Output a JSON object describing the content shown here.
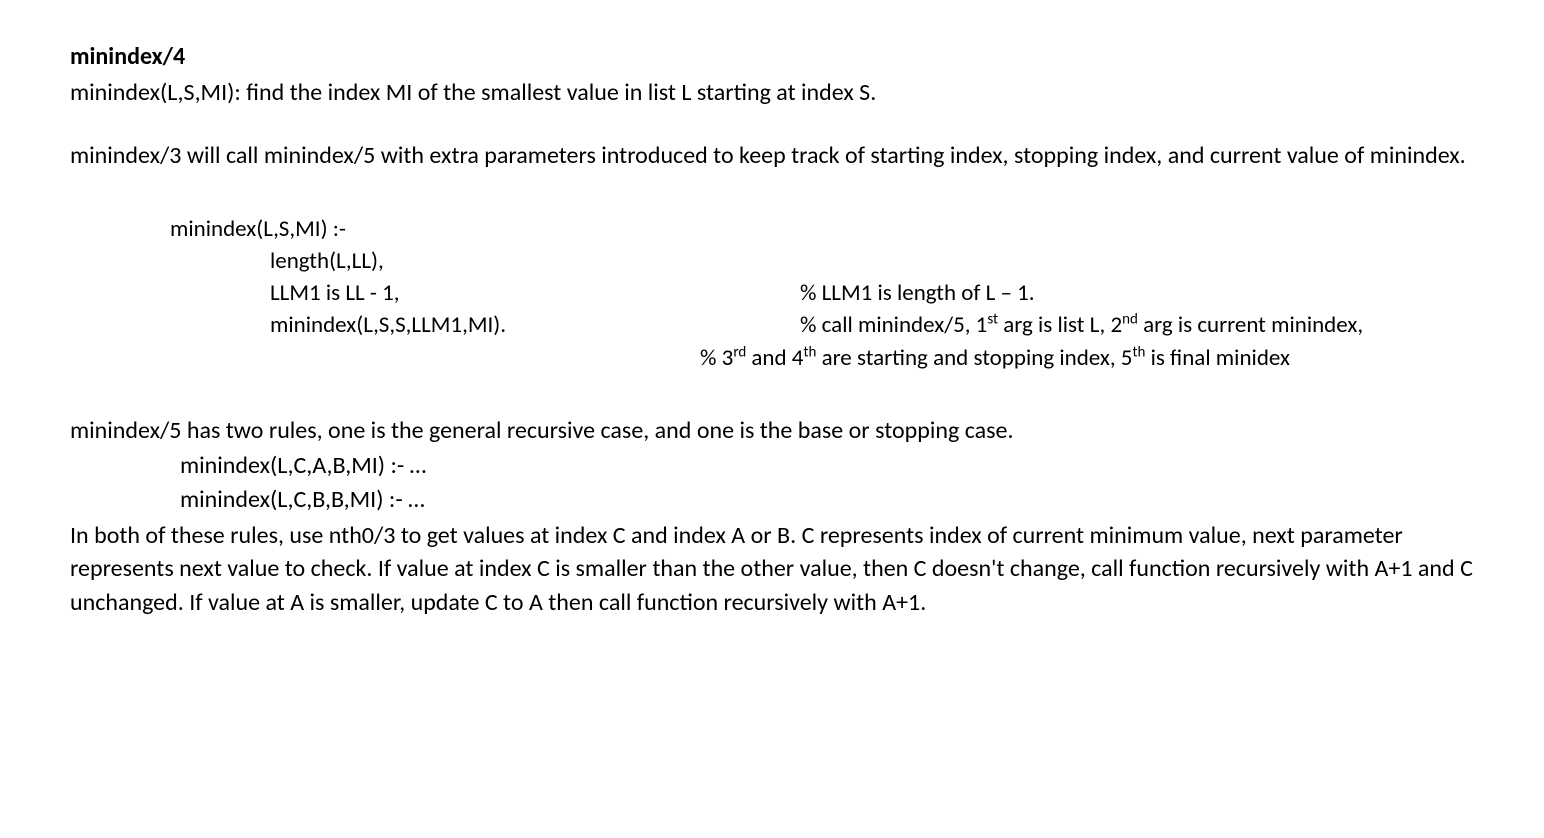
{
  "heading": "minindex/4",
  "desc": "minindex(L,S,MI): find the index MI of the smallest value in list L starting at index S.",
  "para2": "minindex/3 will call minindex/5 with extra parameters introduced to keep track of starting index, stopping index, and current value of minindex.",
  "code": {
    "l1": "minindex(L,S,MI) :-",
    "l2": "length(L,LL),",
    "l3a": "LLM1 is LL - 1,",
    "l3b": "% LLM1 is length of L – 1.",
    "l4a": "minindex(L,S,S,LLM1,MI).",
    "l4b_pre": "% call minindex/5, 1",
    "l4b_sup1": "st",
    "l4b_mid1": " arg is list L, 2",
    "l4b_sup2": "nd",
    "l4b_end1": " arg is current minindex,",
    "l5_pre": "% 3",
    "l5_sup1": "rd",
    "l5_mid1": " and 4",
    "l5_sup2": "th",
    "l5_mid2": " are starting and stopping index, 5",
    "l5_sup3": "th",
    "l5_end": " is final minidex"
  },
  "para3": "minindex/5 has two rules, one is the general recursive case, and one is the base or stopping case.",
  "rule1": "minindex(L,C,A,B,MI) :- …",
  "rule2": "minindex(L,C,B,B,MI) :- …",
  "para4": "In both of these rules, use nth0/3 to get values at index C and index A or B. C represents index of current minimum value, next parameter represents next value to check. If value at index C is smaller than the other value, then C doesn't change, call function recursively with A+1 and C unchanged. If value at A is smaller, update C to A then call function recursively with A+1."
}
